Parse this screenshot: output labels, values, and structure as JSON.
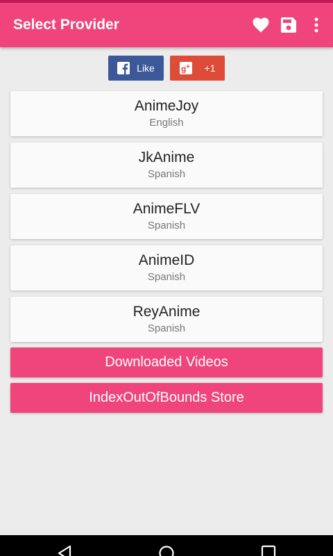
{
  "app_bar": {
    "title": "Select Provider",
    "color": "#f0447c",
    "actions": [
      {
        "name": "favorites",
        "icon": "heart-icon"
      },
      {
        "name": "save",
        "icon": "save-icon"
      },
      {
        "name": "overflow-menu",
        "icon": "more-vert-icon"
      }
    ]
  },
  "social": {
    "facebook_label": "Like",
    "facebook_icon": "facebook-icon",
    "facebook_color": "#3b5998",
    "gplus_label": "+1",
    "gplus_icon": "google-plus-icon",
    "gplus_color": "#dd4b39"
  },
  "providers": [
    {
      "name": "AnimeJoy",
      "language": "English"
    },
    {
      "name": "JkAnime",
      "language": "Spanish"
    },
    {
      "name": "AnimeFLV",
      "language": "Spanish"
    },
    {
      "name": "AnimeID",
      "language": "Spanish"
    },
    {
      "name": "ReyAnime",
      "language": "Spanish"
    }
  ],
  "buttons": {
    "downloaded_label": "Downloaded Videos",
    "store_label": "IndexOutOfBounds Store"
  },
  "nav_bar": {
    "icons": [
      "back-icon",
      "home-icon",
      "recents-icon"
    ]
  }
}
